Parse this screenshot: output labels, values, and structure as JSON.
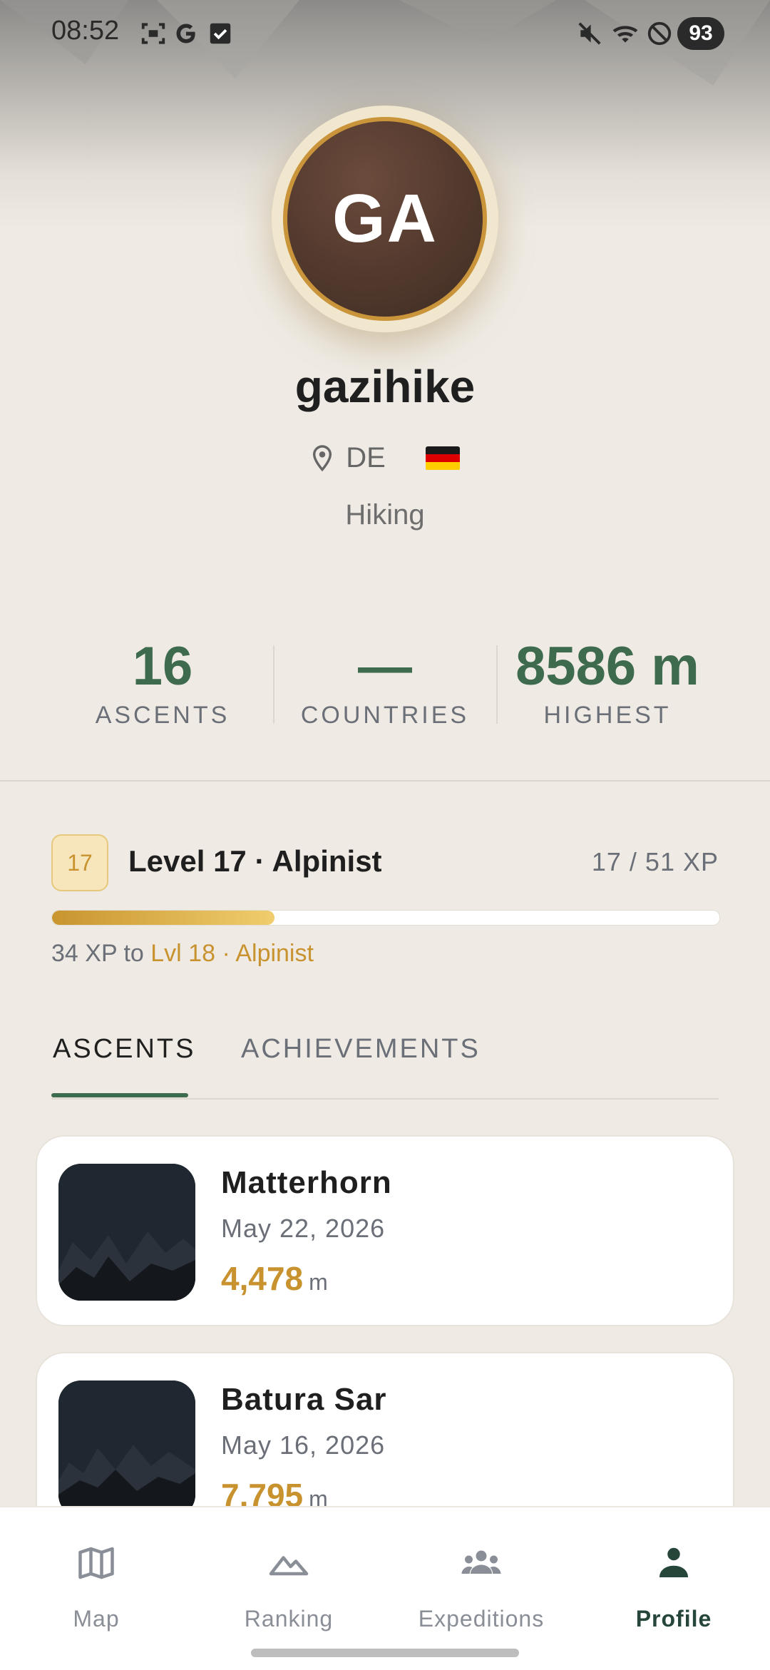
{
  "status_bar": {
    "time": "08:52",
    "battery": "93",
    "left_icons": [
      "screenshot-icon",
      "google-icon",
      "checkbox-icon"
    ],
    "right_icons": [
      "mute-icon",
      "wifi-icon",
      "do-not-disturb-icon"
    ]
  },
  "profile": {
    "initials": "GA",
    "username": "gazihike",
    "country_code": "DE",
    "flag": "germany-flag",
    "activity": "Hiking"
  },
  "stats": [
    {
      "value": "16",
      "label": "ASCENTS"
    },
    {
      "value": "—",
      "label": "COUNTRIES"
    },
    {
      "value": "8586 m",
      "label": "HIGHEST"
    }
  ],
  "level": {
    "badge": "17",
    "title": "Level 17 · Alpinist",
    "xp": "17 / 51 XP",
    "progress_fraction": 0.333,
    "xp_to_prefix": "34 XP to",
    "xp_to_next": "Lvl 18 · Alpinist"
  },
  "tabs": [
    {
      "label": "ASCENTS",
      "active": true
    },
    {
      "label": "ACHIEVEMENTS",
      "active": false
    }
  ],
  "ascents": [
    {
      "name": "Matterhorn",
      "date": "May 22, 2026",
      "elevation": "4,478",
      "unit": "m"
    },
    {
      "name": "Batura Sar",
      "date": "May 16, 2026",
      "elevation": "7,795",
      "unit": "m"
    }
  ],
  "nav": [
    {
      "label": "Map",
      "icon": "map-icon",
      "active": false
    },
    {
      "label": "Ranking",
      "icon": "mountain-icon",
      "active": false
    },
    {
      "label": "Expeditions",
      "icon": "group-icon",
      "active": false
    },
    {
      "label": "Profile",
      "icon": "person-icon",
      "active": true
    }
  ],
  "colors": {
    "accent_green": "#3e6a4e",
    "accent_gold": "#c8922f",
    "background": "#efebe4"
  }
}
